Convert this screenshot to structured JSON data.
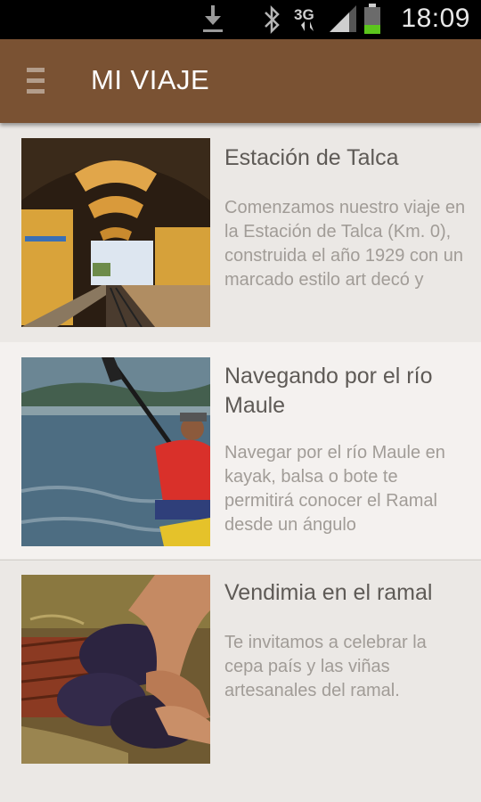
{
  "status_bar": {
    "time": "18:09",
    "network": "3G",
    "icons": [
      "download-icon",
      "bluetooth-icon",
      "network-3g-icon",
      "signal-icon",
      "battery-icon"
    ]
  },
  "app_bar": {
    "title": "MI VIAJE",
    "menu_icon": "hamburger-menu-icon",
    "color": "#7a5233"
  },
  "trips": [
    {
      "title": "Estación de Talca",
      "description": "Comenzamos nuestro viaje en la Estación de Talca (Km. 0), construida el año 1929 con un marcado estilo art decó y",
      "image": "train-station-photo"
    },
    {
      "title": "Navegando por el río Maule",
      "description": "Navegar por el río Maule en kayak, balsa o bote te permitirá conocer el Ramal desde un ángulo",
      "image": "kayak-photo"
    },
    {
      "title": "Vendimia en el ramal",
      "description": "Te invitamos a celebrar la cepa país y las viñas artesanales del ramal.",
      "image": "grape-harvest-photo"
    }
  ]
}
